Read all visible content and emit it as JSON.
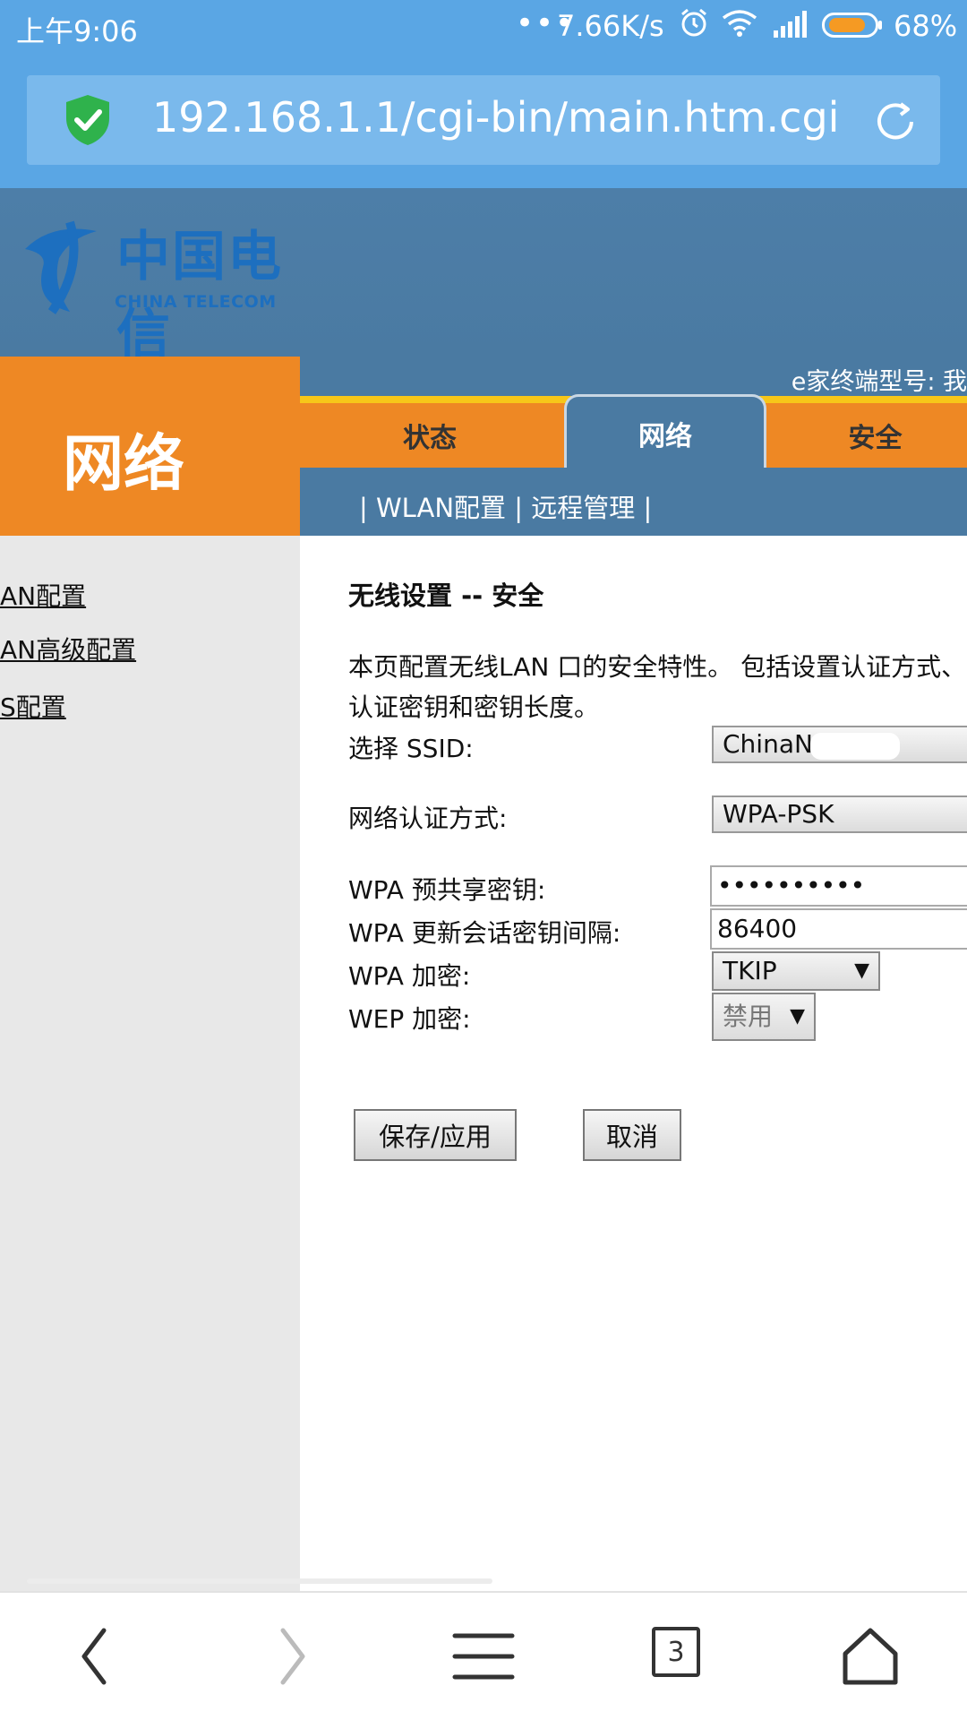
{
  "status_bar": {
    "time": "上午9:06",
    "dots": "•••",
    "speed": "7.66K/s",
    "battery_percent": "68%",
    "icons": [
      "alarm-icon",
      "wifi-icon",
      "signal-icon",
      "battery-icon"
    ]
  },
  "address_bar": {
    "url": "192.168.1.1/cgi-bin/main.htm.cgi",
    "icons": [
      "security-shield-icon",
      "reload-icon"
    ]
  },
  "header": {
    "logo_cn": "中国电信",
    "logo_en": "CHINA TELECOM",
    "device_info": "e家终端型号: 我"
  },
  "section_title": "网络",
  "tabs": [
    {
      "label": "状态",
      "active": false
    },
    {
      "label": "网络",
      "active": true
    },
    {
      "label": "安全",
      "active": false
    }
  ],
  "subnav": "| WLAN配置 | 远程管理 |",
  "left_menu": [
    {
      "label": "AN配置"
    },
    {
      "label": "AN高级配置"
    },
    {
      "label": "S配置"
    }
  ],
  "content": {
    "title": "无线设置 -- 安全",
    "description_line1": "本页配置无线LAN 口的安全特性。 包括设置认证方式、",
    "description_line2": "认证密钥和密钥长度。",
    "fields": {
      "ssid_label": "选择 SSID:",
      "ssid_value": "ChinaNet",
      "auth_label": "网络认证方式:",
      "auth_value": "WPA-PSK",
      "psk_label": "WPA 预共享密钥:",
      "psk_value": "••••••••••",
      "rekey_label": "WPA 更新会话密钥间隔:",
      "rekey_value": "86400",
      "wpa_enc_label": "WPA 加密:",
      "wpa_enc_value": "TKIP",
      "wep_enc_label": "WEP 加密:",
      "wep_enc_value": "禁用"
    },
    "buttons": {
      "save": "保存/应用",
      "cancel": "取消"
    }
  },
  "bottom_nav": {
    "tab_count": "3",
    "icons": [
      "back-icon",
      "forward-icon",
      "menu-icon",
      "tabs-icon",
      "home-icon"
    ]
  },
  "colors": {
    "browser_blue": "#5aa6e4",
    "header_blue": "#4a7aa2",
    "orange": "#ee8824",
    "yellow": "#f7c719"
  }
}
